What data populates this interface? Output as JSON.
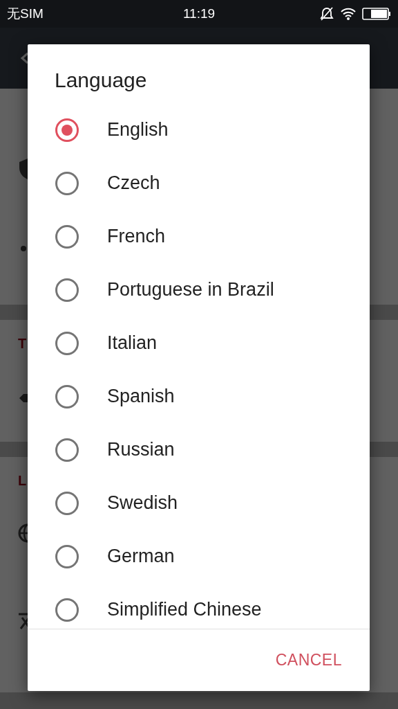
{
  "status_bar": {
    "carrier": "无SIM",
    "time": "11:19"
  },
  "background": {
    "sections": [
      {
        "header": "T"
      },
      {
        "header": "L"
      }
    ]
  },
  "dialog": {
    "title": "Language",
    "options": [
      {
        "label": "English",
        "selected": true
      },
      {
        "label": "Czech",
        "selected": false
      },
      {
        "label": "French",
        "selected": false
      },
      {
        "label": "Portuguese in Brazil",
        "selected": false
      },
      {
        "label": "Italian",
        "selected": false
      },
      {
        "label": "Spanish",
        "selected": false
      },
      {
        "label": "Russian",
        "selected": false
      },
      {
        "label": "Swedish",
        "selected": false
      },
      {
        "label": "German",
        "selected": false
      },
      {
        "label": "Simplified Chinese",
        "selected": false
      }
    ],
    "cancel": "CANCEL"
  }
}
